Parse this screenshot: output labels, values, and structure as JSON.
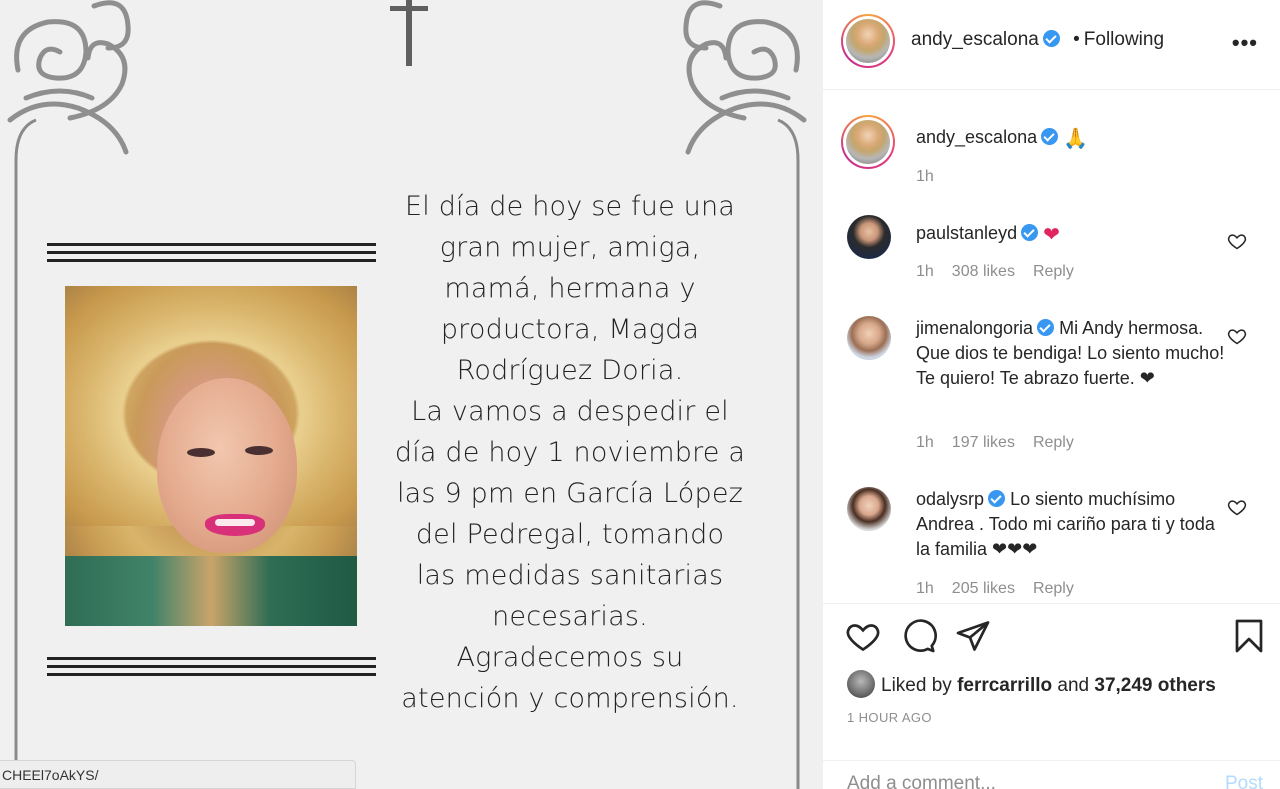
{
  "post_image": {
    "text_lines": [
      "El día de hoy se fue una",
      "gran mujer, amiga,",
      "mamá, hermana y",
      "productora, Magda",
      "Rodríguez Doria.",
      "La vamos a despedir el",
      "día de hoy  1 noviembre a",
      "las 9 pm en García López",
      "del Pedregal, tomando",
      "las medidas sanitarias",
      "necesarias.",
      "Agradecemos su",
      "atención y comprensión."
    ],
    "url_tooltip": "CHEEl7oAkYS/"
  },
  "header": {
    "username": "andy_escalona",
    "dot": "•",
    "following": "Following",
    "more": "•••"
  },
  "caption": {
    "username": "andy_escalona",
    "text": "🙏",
    "time": "1h"
  },
  "comments": [
    {
      "username": "paulstanleyd",
      "text": "❤",
      "time": "1h",
      "likes": "308 likes",
      "reply": "Reply"
    },
    {
      "username": "jimenalongoria",
      "text": "Mi Andy hermosa. Que dios te bendiga! Lo siento mucho! Te quiero! Te abrazo fuerte. ❤",
      "time": "1h",
      "likes": "197 likes",
      "reply": "Reply"
    },
    {
      "username": "odalysrp",
      "text": "Lo siento muchísimo Andrea . Todo mi cariño para ti y toda la familia ❤❤❤",
      "time": "1h",
      "likes": "205 likes",
      "reply": "Reply"
    }
  ],
  "likes_line": {
    "prefix": "Liked by",
    "user": "ferrcarrillo",
    "and": "and",
    "others": "37,249 others"
  },
  "time_ago": "1 HOUR AGO",
  "add_comment": {
    "placeholder": "Add a comment...",
    "post": "Post"
  },
  "colors": {
    "verified": "#3897f0",
    "heart_red": "#e0245e",
    "post_disabled": "#b3dbff",
    "muted": "#8e8e8e"
  }
}
